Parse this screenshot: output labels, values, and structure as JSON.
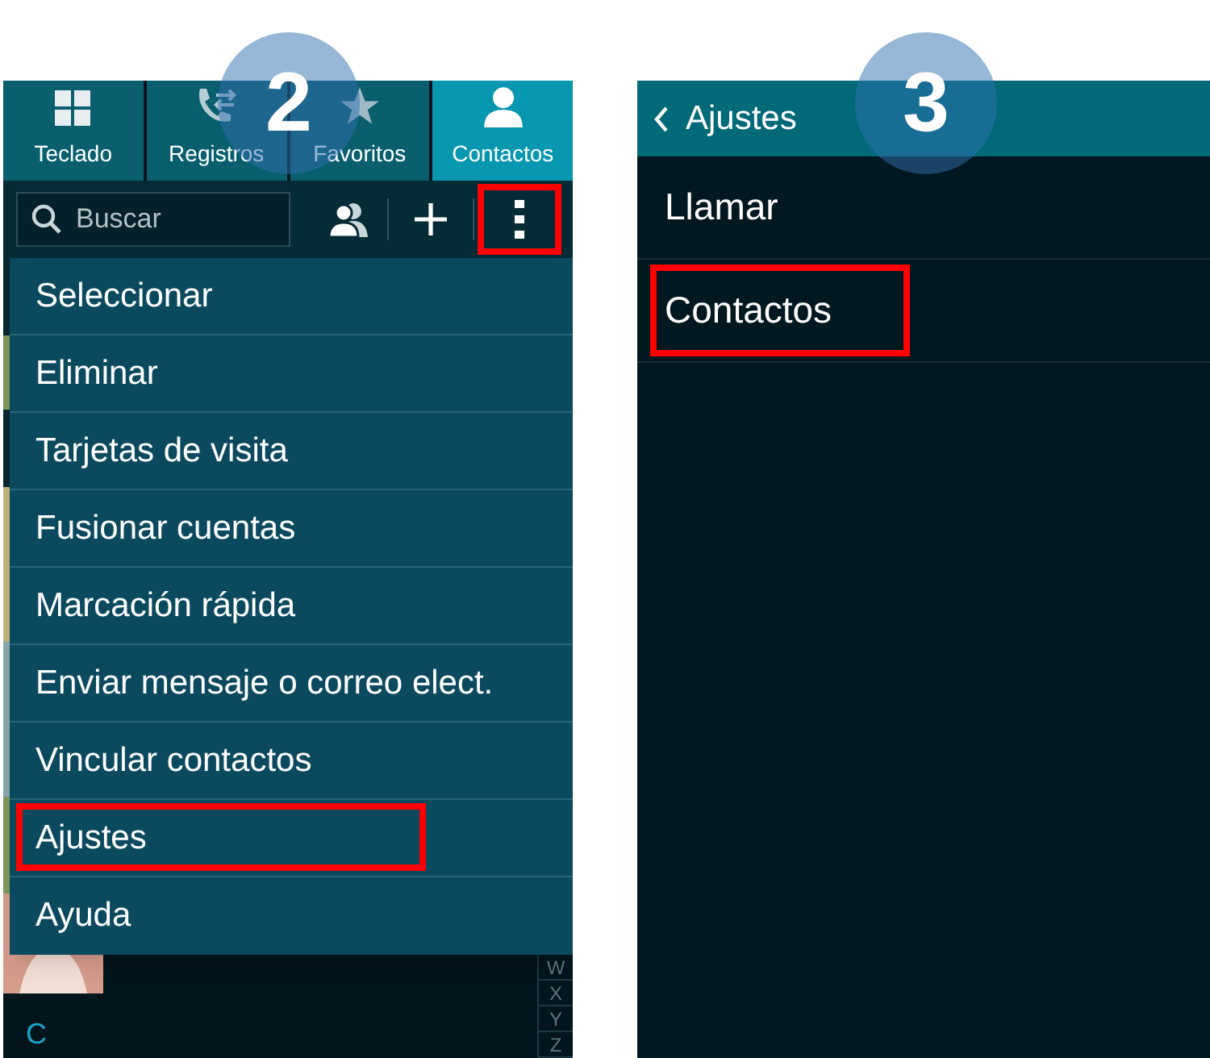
{
  "left_screen": {
    "step": "2",
    "tabs": [
      {
        "label": "Teclado",
        "selected": false
      },
      {
        "label": "Registros",
        "selected": false
      },
      {
        "label": "Favoritos",
        "selected": false
      },
      {
        "label": "Contactos",
        "selected": true
      }
    ],
    "search": {
      "placeholder": "Buscar"
    },
    "more_button": {
      "highlighted": true
    },
    "menu": [
      {
        "label": "Seleccionar",
        "highlighted": false
      },
      {
        "label": "Eliminar",
        "highlighted": false
      },
      {
        "label": "Tarjetas de visita",
        "highlighted": false
      },
      {
        "label": "Fusionar cuentas",
        "highlighted": false
      },
      {
        "label": "Marcación rápida",
        "highlighted": false
      },
      {
        "label": "Enviar mensaje o correo elect.",
        "highlighted": false
      },
      {
        "label": "Vincular contactos",
        "highlighted": false
      },
      {
        "label": "Ajustes",
        "highlighted": true
      },
      {
        "label": "Ayuda",
        "highlighted": false
      }
    ],
    "index_letters": [
      "W",
      "X",
      "Y",
      "Z"
    ],
    "section_header": "C"
  },
  "right_screen": {
    "step": "3",
    "title": "Ajustes",
    "items": [
      {
        "label": "Llamar",
        "highlighted": false
      },
      {
        "label": "Contactos",
        "highlighted": true
      }
    ]
  }
}
